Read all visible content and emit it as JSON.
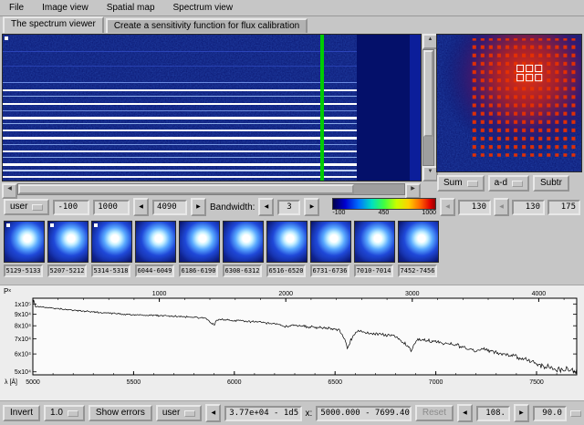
{
  "colors": {
    "ui_bg": "#c6c6c6",
    "image_blue": "#0a1670",
    "dark_band_blue": "#04106a",
    "cursor_green": "#00cc00",
    "marker_red": "#e83000"
  },
  "menu": {
    "items": [
      "File",
      "Image view",
      "Spatial map",
      "Spectrum view"
    ]
  },
  "tabs": {
    "spectrum_viewer": "The spectrum viewer",
    "sensitivity": "Create a sensitivity function for flux calibration"
  },
  "zoom_controls": {
    "sum": "Sum",
    "combine_mode": "a-d",
    "subtract": "Subtr"
  },
  "toolbar": {
    "scale_mode": "user",
    "cut_min": "-100",
    "cut_max": "1000",
    "frame": "4090",
    "bandwidth_label": "Bandwidth:",
    "bandwidth": "3",
    "colorbar_min": "-100",
    "colorbar_mid": "450",
    "colorbar_max": "1000",
    "pos_x": "130",
    "pos_y": "130",
    "pos_z": "175"
  },
  "thumbnails": [
    "5129-5133",
    "5207-5212",
    "5314-5318",
    "6044-6049",
    "6186-6190",
    "6308-6312",
    "6516-6520",
    "6731-6736",
    "7010-7014",
    "7452-7456"
  ],
  "chart_data": {
    "type": "line",
    "title": "",
    "flux_label": "Pˣ",
    "xlabel": "λ [Å]",
    "x_domain": [
      5000,
      7699.4
    ],
    "y_domain": [
      48500,
      106000
    ],
    "y_scale": "log",
    "y_ticks": [
      {
        "label": "1x10⁵",
        "value": 100000
      },
      {
        "label": "9x10⁴",
        "value": 90000
      },
      {
        "label": "8x10⁴",
        "value": 80000
      },
      {
        "label": "7x10⁴",
        "value": 70000
      },
      {
        "label": "6x10⁴",
        "value": 60000
      },
      {
        "label": "5x10⁴",
        "value": 50000
      }
    ],
    "x_ticks_bottom": [
      5000,
      5500,
      6000,
      6500,
      7000,
      7500
    ],
    "x_ticks_top": {
      "pixel_ticks": [
        1000,
        2000,
        3000,
        4000
      ],
      "pixel_range": [
        0,
        4300
      ]
    },
    "noise": {
      "base": 700,
      "slope": 1100,
      "seed": 42
    },
    "anchors": [
      [
        5000,
        99500
      ],
      [
        5004,
        104000
      ],
      [
        5012,
        97500
      ],
      [
        5050,
        96800
      ],
      [
        5100,
        95800
      ],
      [
        5200,
        93800
      ],
      [
        5300,
        92200
      ],
      [
        5400,
        90800
      ],
      [
        5500,
        89600
      ],
      [
        5600,
        88900
      ],
      [
        5700,
        88300
      ],
      [
        5800,
        87200
      ],
      [
        5860,
        86300
      ],
      [
        5888,
        81500
      ],
      [
        5902,
        80800
      ],
      [
        5915,
        85200
      ],
      [
        6000,
        84600
      ],
      [
        6100,
        83200
      ],
      [
        6200,
        81700
      ],
      [
        6265,
        79200
      ],
      [
        6290,
        80600
      ],
      [
        6350,
        79600
      ],
      [
        6450,
        78100
      ],
      [
        6520,
        77000
      ],
      [
        6545,
        71000
      ],
      [
        6562,
        63500
      ],
      [
        6578,
        69500
      ],
      [
        6610,
        75600
      ],
      [
        6700,
        73600
      ],
      [
        6800,
        71600
      ],
      [
        6858,
        66000
      ],
      [
        6878,
        62500
      ],
      [
        6905,
        69800
      ],
      [
        7000,
        68000
      ],
      [
        7100,
        66000
      ],
      [
        7165,
        63200
      ],
      [
        7195,
        61500
      ],
      [
        7230,
        63400
      ],
      [
        7300,
        61000
      ],
      [
        7400,
        58500
      ],
      [
        7460,
        56000
      ],
      [
        7520,
        53500
      ],
      [
        7600,
        51500
      ],
      [
        7699.4,
        50500
      ]
    ]
  },
  "bottom_bar": {
    "invert": "Invert",
    "zoom_factor": "1.0",
    "show_errors": "Show errors",
    "mode": "user",
    "y_range": "3.77e+04 - 1d5",
    "x_label": "x:",
    "x_range": "5000.000 - 7699.400",
    "reset": "Reset",
    "step": "108.",
    "angle": "90.0"
  }
}
